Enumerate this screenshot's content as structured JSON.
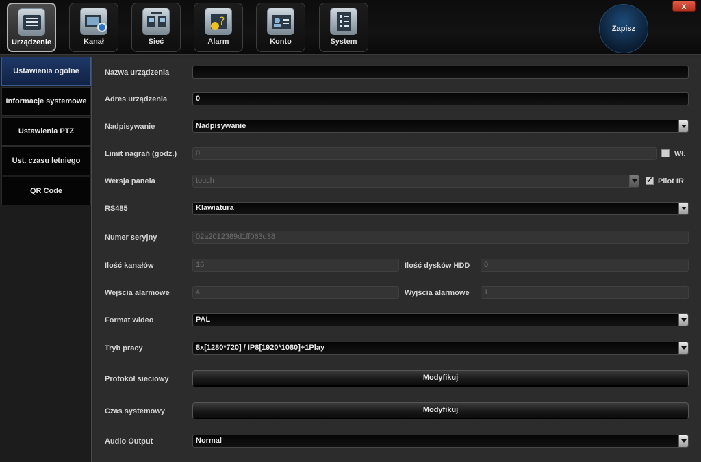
{
  "window": {
    "close_label": "x"
  },
  "tabs": [
    {
      "label": "Urządzenie",
      "icon": "device-settings-icon",
      "active": true
    },
    {
      "label": "Kanał",
      "icon": "camera-channel-icon",
      "active": false
    },
    {
      "label": "Sieć",
      "icon": "network-icon",
      "active": false
    },
    {
      "label": "Alarm",
      "icon": "alarm-icon",
      "active": false
    },
    {
      "label": "Konto",
      "icon": "account-icon",
      "active": false
    },
    {
      "label": "System",
      "icon": "system-icon",
      "active": false
    }
  ],
  "save_button": {
    "label": "Zapisz"
  },
  "sidebar": {
    "items": [
      {
        "label": "Ustawienia ogólne",
        "active": true
      },
      {
        "label": "Informacje systemowe",
        "active": false
      },
      {
        "label": "Ustawienia PTZ",
        "active": false
      },
      {
        "label": "Ust. czasu letniego",
        "active": false
      },
      {
        "label": "QR Code",
        "active": false
      }
    ]
  },
  "form": {
    "device_name": {
      "label": "Nazwa urządzenia",
      "value": ""
    },
    "device_address": {
      "label": "Adres urządzenia",
      "value": "0"
    },
    "overwrite": {
      "label": "Nadpisywanie",
      "value": "Nadpisywanie"
    },
    "record_limit": {
      "label": "Limit nagrań (godz.)",
      "value": "0",
      "checkbox_label": "Wł.",
      "checked": false
    },
    "panel_version": {
      "label": "Wersja panela",
      "value": "touch",
      "checkbox_label": "Pilot IR",
      "checked": true
    },
    "rs485": {
      "label": "RS485",
      "value": "Klawiatura"
    },
    "serial_number": {
      "label": "Numer seryjny",
      "value": "02a2012389d1ff063d38"
    },
    "channel_count": {
      "label": "Ilość kanałów",
      "value": "16"
    },
    "hdd_count": {
      "label": "Ilość dysków HDD",
      "value": "0"
    },
    "alarm_inputs": {
      "label": "Wejścia alarmowe",
      "value": "4"
    },
    "alarm_outputs": {
      "label": "Wyjścia alarmowe",
      "value": "1"
    },
    "video_format": {
      "label": "Format wideo",
      "value": "PAL"
    },
    "work_mode": {
      "label": "Tryb pracy",
      "value": "8x[1280*720] / IP8[1920*1080]+1Play"
    },
    "network_protocol": {
      "label": "Protokół sieciowy",
      "button": "Modyfikuj"
    },
    "system_time": {
      "label": "Czas systemowy",
      "button": "Modyfikuj"
    },
    "audio_output": {
      "label": "Audio Output",
      "value": "Normal"
    }
  }
}
